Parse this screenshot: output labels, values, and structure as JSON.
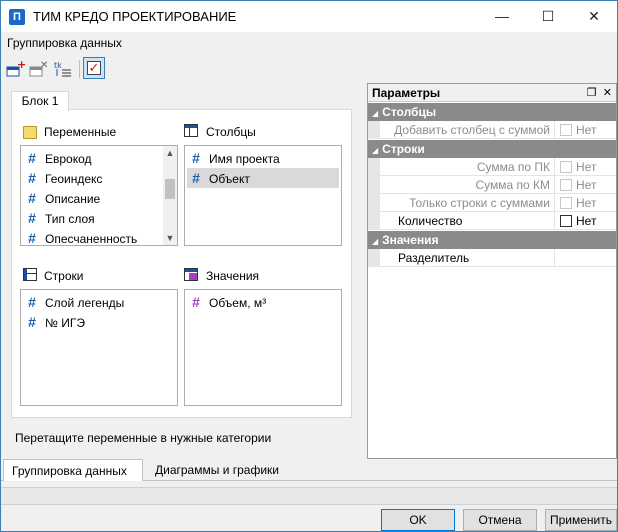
{
  "window": {
    "title": "ТИМ КРЕДО ПРОЕКТИРОВАНИЕ",
    "app_icon_letter": "П"
  },
  "menu": {
    "item": "Группировка данных"
  },
  "tabs": {
    "block": "Блок 1"
  },
  "groups": {
    "variables": {
      "label": "Переменные",
      "items": [
        "Еврокод",
        "Геоиндекс",
        "Описание",
        "Тип слоя",
        "Опесчаненность"
      ]
    },
    "columns": {
      "label": "Столбцы",
      "items": [
        "Имя проекта",
        "Объект"
      ],
      "selected": "Объект"
    },
    "rows": {
      "label": "Строки",
      "items": [
        "Слой легенды",
        "№ ИГЭ"
      ]
    },
    "values": {
      "label": "Значения",
      "items": [
        "Объем, м³"
      ]
    }
  },
  "hint": "Перетащите переменные в нужные категории",
  "params": {
    "title": "Параметры",
    "categories": [
      {
        "name": "Столбцы",
        "rows": [
          {
            "name": "Добавить столбец с суммой",
            "value": "Нет",
            "enabled": false
          }
        ]
      },
      {
        "name": "Строки",
        "rows": [
          {
            "name": "Сумма по ПК",
            "value": "Нет",
            "enabled": false
          },
          {
            "name": "Сумма по КМ",
            "value": "Нет",
            "enabled": false
          },
          {
            "name": "Только строки с суммами",
            "value": "Нет",
            "enabled": false
          },
          {
            "name": "Количество",
            "value": "Нет",
            "enabled": true
          }
        ]
      },
      {
        "name": "Значения",
        "rows": [
          {
            "name": "Разделитель",
            "value": "",
            "enabled": true
          }
        ]
      }
    ]
  },
  "bottom_tabs": [
    "Группировка данных",
    "Диаграммы и графики"
  ],
  "buttons": {
    "ok": "OK",
    "cancel": "Отмена",
    "apply": "Применить"
  }
}
